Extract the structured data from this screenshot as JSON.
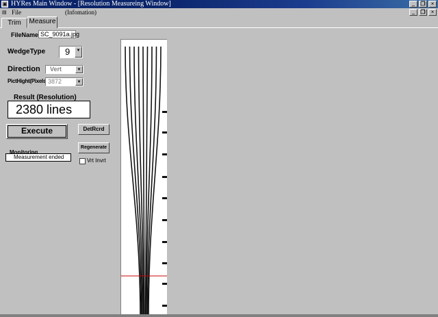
{
  "window": {
    "title": "HYRes Main Window - [Resolution Measureing Window]"
  },
  "menu": {
    "file": "File",
    "information": "(Infomation)"
  },
  "tabs": [
    {
      "label": "Trim"
    },
    {
      "label": "Measure"
    }
  ],
  "form": {
    "filename_label": "FileName",
    "filename_value": "SC_9091a.jpg",
    "wedge_type_label": "WedgeType",
    "wedge_type_value": "9",
    "direction_label": "Direction",
    "direction_value": "Vert",
    "pict_height_label": "PictHight(Pixels)",
    "pict_height_value": "3872",
    "result_label": "Result (Resolution)",
    "result_value": "2380 lines",
    "execute_label": "Execute",
    "detrcrd_label": "DetRcrd",
    "regenerate_label": "Regenerate",
    "monitoring_label": "Monitoring",
    "monitoring_value": "Measurement ended",
    "vrt_invrt_label": "Vrt Invrt",
    "vrt_invrt_checked": false
  },
  "icons": {
    "app": "app-icon",
    "minimize": "minimize-icon",
    "restore": "restore-icon",
    "close": "close-icon",
    "dropdown": "chevron-down-icon"
  },
  "colors": {
    "titlebar": "#0a246a",
    "measure_line": "#cc0000",
    "face": "#c0c0c0"
  }
}
